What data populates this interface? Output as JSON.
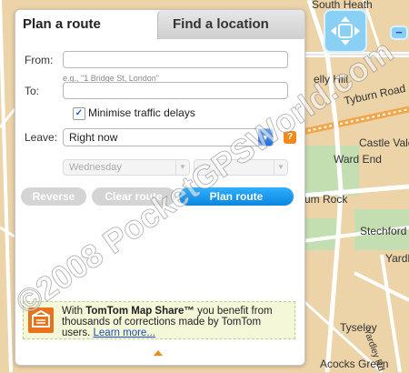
{
  "map": {
    "labels": [
      "South Heath",
      "elly Hill",
      "Tyburn Road",
      "Castle Vale",
      "Ward End",
      "um Rock",
      "Stechford",
      "Yardl",
      "Tyseley",
      "Yardley Rd",
      "Acocks Green"
    ]
  },
  "panel": {
    "tabs": {
      "active": "Plan a route",
      "inactive": "Find a location"
    },
    "from_label": "From:",
    "from_value": "",
    "from_hint": "e.g., \"1 Bridge St, London\"",
    "to_label": "To:",
    "to_value": "",
    "checkbox_label": "Minimise traffic delays",
    "checkbox_checked": true,
    "leave_label": "Leave:",
    "leave_value": "Right now",
    "help_label": "?",
    "day_value": "Wednesday",
    "buttons": {
      "reverse": "Reverse",
      "clear": "Clear route",
      "plan": "Plan route"
    },
    "share": {
      "prefix": "With ",
      "brand": "TomTom Map Share™",
      "text": " you benefit from thousands of corrections made by TomTom users. ",
      "link": "Learn more..."
    }
  },
  "watermark": "©2008 PocketGPSWorld.com",
  "colors": {
    "map_bg": "#ecd3a8",
    "map_green": "#c3deb0",
    "accent_blue": "#0b86e0",
    "help_orange": "#f08a1b"
  }
}
